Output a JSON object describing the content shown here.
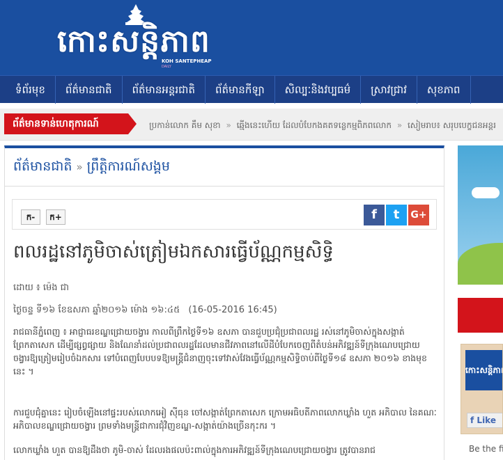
{
  "logo": {
    "text": "កោះសន្តិភាព",
    "sub1": "KOH SANTEPHEAP",
    "sub2": "DAILY"
  },
  "nav": {
    "items": [
      {
        "label": "ទំព័រមុខ"
      },
      {
        "label": "ព័ត៌មានជាតិ"
      },
      {
        "label": "ព័ត៌មានអន្តរជាតិ"
      },
      {
        "label": "ព័ត៌មានកីឡា"
      },
      {
        "label": "សិល្បៈនិងវប្បធម៌"
      },
      {
        "label": "ស្រាវជ្រាវ"
      },
      {
        "label": "សុខភាព"
      }
    ]
  },
  "breaking": {
    "label": "ព័ត៌មានទាន់ហេតុការណ៍",
    "ticker": [
      "ប្រកាន់លោក គឹម សុខា",
      "ឆ្មើងនេះហើយ ដែលបំបែកងគតទន្លេកម្មពិភពលោក",
      "សៀមរាប៖ សរុបបេក្ខជនអន្តរ"
    ]
  },
  "breadcrumb": {
    "section": "ព័ត៌មានជាតិ",
    "subsection": "ព្រឹត្តិការណ៍សង្គម"
  },
  "toolbar": {
    "font_decrease": "ក-",
    "font_increase": "ក+"
  },
  "share": {
    "facebook": "f",
    "twitter": "t",
    "google": "G+"
  },
  "article": {
    "title": "ពលរដ្ឋនៅភូមិចាស់ត្រៀមឯកសារធ្វើប័ណ្ណកម្មសិទ្ធិ",
    "byline": "ដោយ ៖ ម៉េង ជា",
    "date_km": "ថ្ងៃចន្ទ ទី១៦ ខែឧសភា ឆ្នាំ២០១៦ ម៉ោង ១៦:៤៥",
    "date_num": "(16-05-2016 16:45)",
    "p1": "រាជធានីភ្នំពេញ ៖ អាជ្ញាធរខណ្ឌជ្រោយចង្វារ កាលពីព្រឹកថ្ងៃទី១៦ ឧសភា បានជួបប្រជុំប្រជាពលរដ្ឋ រស់នៅភូមិចាស់ក្នុងសង្កាត់ព្រែកតាសេក ដើម្បីផ្សព្វផ្សាយ និងណែនាំដល់ប្រជាពលរដ្ឋដែលមានជីវភាពនៅលើដីបំបែកចេញពីតំបន់អភិវឌ្ឍន៍ទីក្រុងណេបជ្រោយចង្វារឱ្យត្រៀមរៀបចំឯកសារ ទៅបំពេញបែបបទឱ្យមន្ត្រីជំនាញចុះទៅវាស់វែងធ្វើប័ណ្ណកម្មសិទ្ធិចាប់ពីថ្ងៃទី១៨ ឧសភា ២០១៦ ខាងមុខនេះ ។",
    "p2": "ការជួបជុំគ្នានេះ រៀបចំឡើងនៅផ្ទះរបស់លោកអៀ ស៊ីធុន ចៅសង្កាត់ព្រែកតាសេក ក្រោមអធិបតីភាពលោកឃ្លាំង ហួត អភិបាល នៃគណៈអភិបាលខណ្ឌជ្រោយចង្វារ ព្រមទាំងមន្ត្រីជាការជុំវិញខណ្ឌ-សង្កាត់យ៉ាងច្រើនកុះករ ។",
    "p3": "លោកឃ្លាំង ហួត បានឱ្យដឹងថា ភូមិ-ចាស់ ដែលរងផលប៉ះពាល់ក្នុងការអភិវឌ្ឍន៍ទីក្រុងណេបជ្រោយចង្វារ ត្រូវបានរាជ"
  },
  "sidebar": {
    "logo_text": "កោះសន្តិភាព",
    "like_label": "Like",
    "bottom_text": "Be the fi"
  },
  "colors": {
    "brand_blue": "#1a4fa0",
    "nav_blue": "#1c3f86",
    "breaking_red": "#d3141b",
    "facebook": "#3b5998",
    "twitter": "#1da1f2",
    "google": "#dd4b39"
  }
}
